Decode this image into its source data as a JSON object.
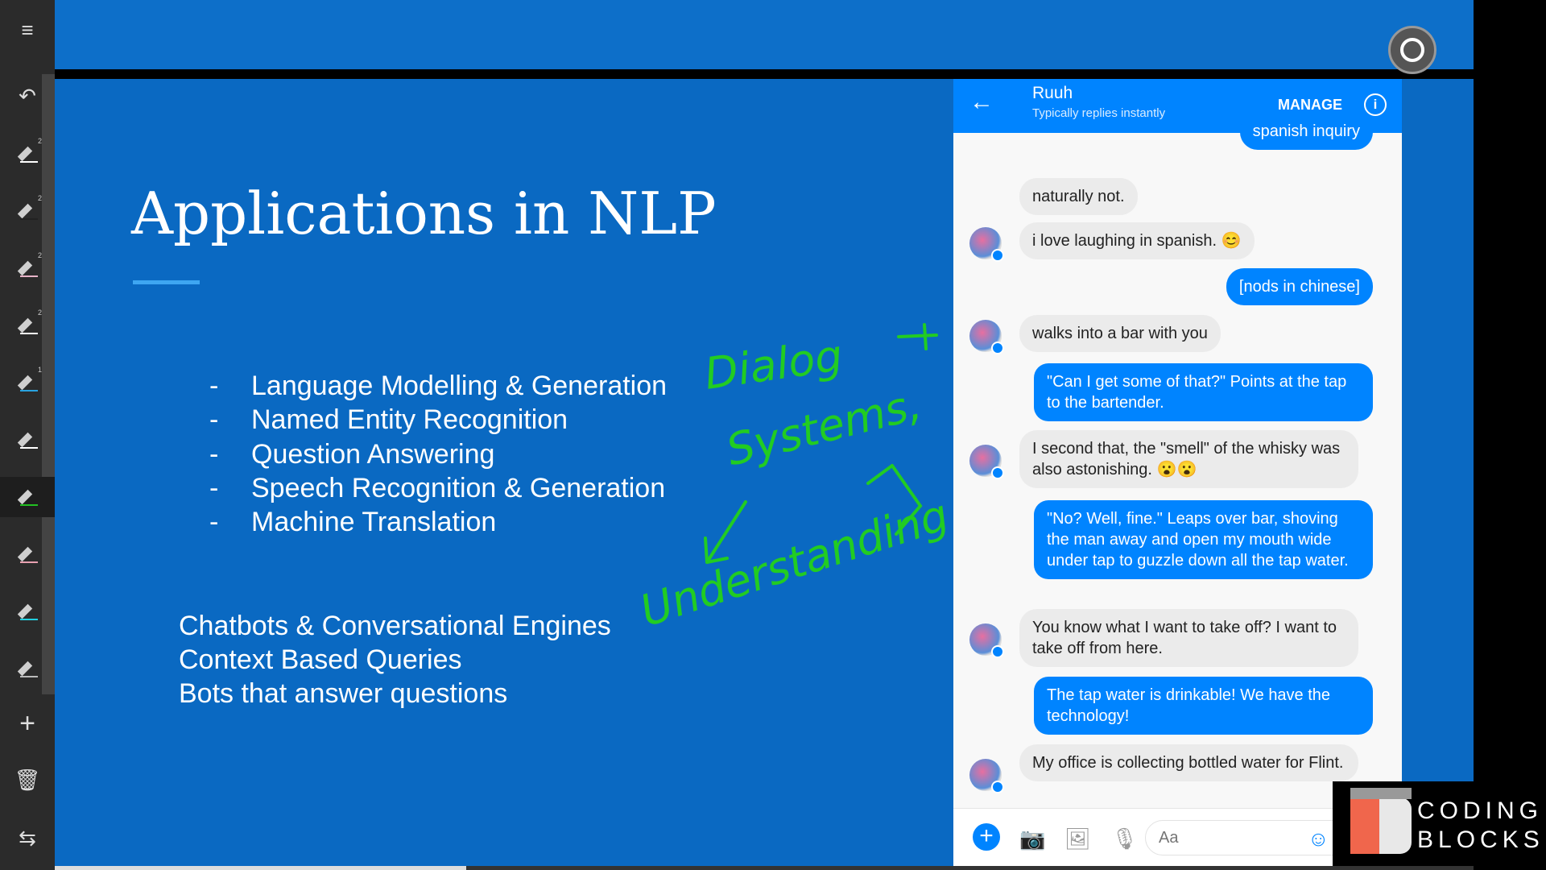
{
  "sidebar": {
    "menu_icon": "menu-icon",
    "undo_icon": "undo-icon",
    "pens": [
      {
        "color": "#ffffff",
        "badge": "2"
      },
      {
        "color": "#222222",
        "badge": "2"
      },
      {
        "color": "#e8b4c8",
        "badge": "2"
      },
      {
        "color": "#ffffff",
        "badge": "2"
      },
      {
        "color": "#29a3e0",
        "badge": "1"
      },
      {
        "color": "#ffffff",
        "badge": ""
      },
      {
        "color": "#22c022",
        "badge": ""
      },
      {
        "color": "#e8a0b0",
        "badge": ""
      },
      {
        "color": "#22d0e0",
        "badge": ""
      },
      {
        "color": "#bbbbbb",
        "badge": ""
      }
    ]
  },
  "slide": {
    "title": "Applications in NLP",
    "bullets": [
      "Language Modelling & Generation",
      "Named Entity Recognition",
      "Question Answering",
      "Speech Recognition & Generation",
      "Machine Translation"
    ],
    "bullet_marker": "-",
    "extra": [
      "Chatbots & Conversational Engines",
      "Context Based Queries",
      "Bots that  answer questions"
    ],
    "annotations": [
      "Dialog",
      "Systems,",
      "Understanding"
    ],
    "annotation_color": "#22cc22"
  },
  "chat": {
    "name": "Ruuh",
    "status": "Typically replies instantly",
    "manage": "MANAGE",
    "messages": [
      {
        "from": "me",
        "text": "spanish inquiry"
      },
      {
        "from": "bot",
        "text": "naturally not."
      },
      {
        "from": "bot",
        "text": "i love laughing in spanish. 😊"
      },
      {
        "from": "me",
        "text": "[nods in chinese]"
      },
      {
        "from": "bot",
        "text": "walks into a bar with you"
      },
      {
        "from": "me",
        "text": "\"Can I get some of that?\" Points at the tap to the bartender."
      },
      {
        "from": "bot",
        "text": "I second that, the \"smell\" of the whisky was also astonishing. 😮😮"
      },
      {
        "from": "me",
        "text": "\"No? Well, fine.\" Leaps over bar, shoving the man away and open my mouth wide under tap to guzzle down all the tap water."
      },
      {
        "from": "bot",
        "text": "You know what I want to take off? I want to take off from here."
      },
      {
        "from": "me",
        "text": "The tap water is drinkable! We have the technology!"
      },
      {
        "from": "bot",
        "text": "My office is collecting bottled water for Flint."
      }
    ],
    "input_placeholder": "Aa"
  },
  "logo": {
    "line1": "CODING",
    "line2": "BLOCKS"
  },
  "video_progress": 0.29
}
